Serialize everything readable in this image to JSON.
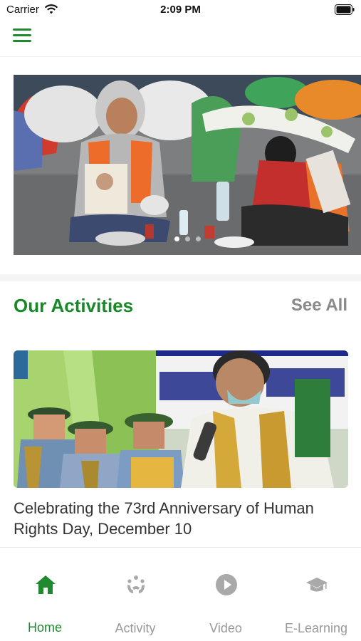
{
  "status_bar": {
    "carrier": "Carrier",
    "time": "2:09 PM"
  },
  "colors": {
    "accent": "#1f8a2e",
    "title_green": "#178a27",
    "muted": "#8a8a8a"
  },
  "icons": {
    "menu": "hamburger-icon",
    "home": "home-icon",
    "activity": "activity-icon",
    "video": "play-icon",
    "elearning": "graduation-cap-icon"
  },
  "carousel": {
    "slide_count": 3,
    "active_index": 0
  },
  "activities": {
    "section_title": "Our Activities",
    "see_all_label": "See All",
    "items": [
      {
        "title": "Celebrating the 73rd Anniversary of Human Rights Day, December 10"
      }
    ]
  },
  "tabs": [
    {
      "label": "Home",
      "active": true
    },
    {
      "label": "Activity",
      "active": false
    },
    {
      "label": "Video",
      "active": false
    },
    {
      "label": "E-Learning",
      "active": false
    }
  ]
}
